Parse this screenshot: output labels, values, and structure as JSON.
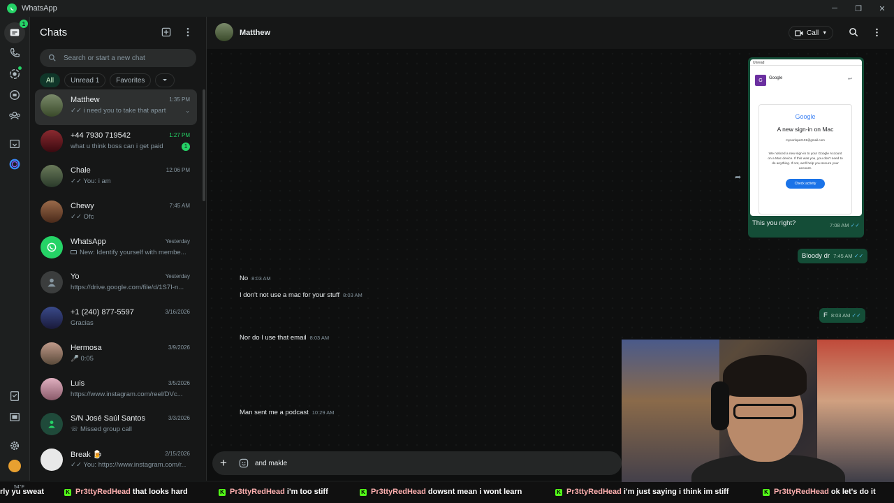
{
  "window": {
    "title": "WhatsApp"
  },
  "rail": {
    "badge": "1"
  },
  "chatlist": {
    "title": "Chats",
    "search_placeholder": "Search or start a new chat",
    "filters": {
      "all": "All",
      "unread": "Unread 1",
      "favorites": "Favorites"
    },
    "chats": [
      {
        "name": "Matthew",
        "time": "1:35 PM",
        "preview": "✓✓ i need you to take that apart",
        "avatar_color": "#5d6b52"
      },
      {
        "name": "+44 7930 719542",
        "time": "1:27 PM",
        "preview": "what u think boss can i get paid",
        "unread": "1",
        "avatar_color": "#6a1a20"
      },
      {
        "name": "Chale",
        "time": "12:06 PM",
        "preview": "✓✓ You: i am",
        "avatar_color": "#4c5a3e"
      },
      {
        "name": "Chewy",
        "time": "7:45 AM",
        "preview": "✓✓ Ofc",
        "avatar_color": "#7a4a3a"
      },
      {
        "name": "WhatsApp",
        "time": "Yesterday",
        "preview": "New: Identify yourself with membe...",
        "avatar_color": "#25d366"
      },
      {
        "name": "Yo",
        "time": "Yesterday",
        "preview": "https://drive.google.com/file/d/1S7I-n...",
        "avatar_color": "#3b3d3d"
      },
      {
        "name": "+1 (240) 877-5597",
        "time": "3/16/2026",
        "preview": "Gracias",
        "avatar_color": "#2a3a6a"
      },
      {
        "name": "Hermosa",
        "time": "3/9/2026",
        "preview": "🎤 0:05",
        "avatar_color": "#a07a6a"
      },
      {
        "name": "Luis",
        "time": "3/5/2026",
        "preview": "https://www.instagram.com/reel/DVc...",
        "avatar_color": "#c08aa0"
      },
      {
        "name": "S/N José Saúl Santos",
        "time": "3/3/2026",
        "preview": "Missed group call",
        "avatar_color": "#1f4a3a"
      },
      {
        "name": "Break 🍺",
        "time": "2/15/2026",
        "preview": "✓✓ You: https://www.instagram.com/r...",
        "avatar_color": "#222"
      }
    ]
  },
  "conversation": {
    "name": "Matthew",
    "call_label": "Call",
    "image_caption": "This you right?",
    "image_time": "7:08 AM",
    "email": {
      "header": "Unread",
      "sender": "Google",
      "brand": "Google",
      "headline": "A new sign-in on Mac",
      "address": "mynorlopez101@gmail.com",
      "body": "We noticed a new sign-in to your Google Account on a Mac device. If this was you, you don't need to do anything. If not, we'll help you secure your account.",
      "button": "Check activity"
    },
    "messages": [
      {
        "dir": "out",
        "text": "Bloody dr",
        "time": "7:45 AM"
      },
      {
        "dir": "in",
        "text": "No",
        "time": "8:03 AM"
      },
      {
        "dir": "in",
        "text": "I don't not use a mac for your stuff",
        "time": "8:03 AM"
      },
      {
        "dir": "out",
        "text": "F",
        "time": "8:03 AM"
      },
      {
        "dir": "in",
        "text": "Nor do I use that email",
        "time": "8:03 AM"
      },
      {
        "dir": "in",
        "text": "Man sent me a podcast",
        "time": "10:29 AM"
      }
    ],
    "composer_value": "and makle"
  },
  "taskbar": {
    "weather": "54°F",
    "ticker": [
      {
        "user": "",
        "msg": "rly yu sweat"
      },
      {
        "user": "Pr3ttyRedHead",
        "msg": "that looks hard"
      },
      {
        "user": "Pr3ttyRedHead",
        "msg": "i'm too stiff"
      },
      {
        "user": "Pr3ttyRedHead",
        "msg": "dowsnt mean i wont learn"
      },
      {
        "user": "Pr3ttyRedHead",
        "msg": "i'm just saying i think im stiff"
      },
      {
        "user": "Pr3ttyRedHead",
        "msg": "ok let's do it"
      }
    ]
  }
}
